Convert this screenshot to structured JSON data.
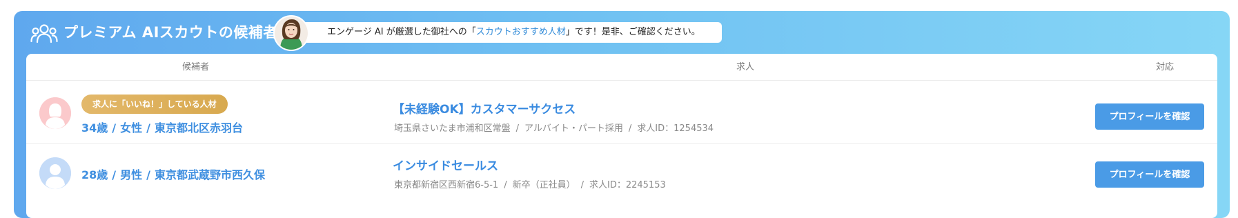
{
  "header": {
    "title": "プレミアム AIスカウトの候補者",
    "message_before": "エンゲージ AI が厳選した御社への「",
    "message_highlight": "スカウトおすすめ人材",
    "message_after": "」です！是非、ご確認ください。"
  },
  "columns": {
    "candidate": "候補者",
    "job": "求人",
    "action": "対応"
  },
  "rows": [
    {
      "badge": "求人に「いいね！」している人材",
      "age": "34歳",
      "gender": "女性",
      "location": "東京都北区赤羽台",
      "avatar_color": "#f6b8bb",
      "job_title": "【未経験OK】カスタマーサクセス",
      "job_location": "埼玉県さいたま市浦和区常盤",
      "job_type": "アルバイト・パート採用",
      "job_id": "求人ID：1254534",
      "button": "プロフィールを確認"
    },
    {
      "age": "28歳",
      "gender": "男性",
      "location": "東京都武蔵野市西久保",
      "avatar_color": "#b7d3f6",
      "job_title": "インサイドセールス",
      "job_location": "東京都新宿区西新宿6-5-1",
      "job_type": "新卒（正社員）",
      "job_id": "求人ID：2245153",
      "button": "プロフィールを確認"
    }
  ],
  "colors": {
    "accent": "#4a9be6",
    "gradient_start": "#5fa8ee",
    "gradient_end": "#86d6f6",
    "badge_gold": "#dcae5b"
  },
  "icons": {
    "header": "people-group-icon",
    "advisor": "advisor-avatar",
    "candidate": "person-silhouette-icon"
  }
}
